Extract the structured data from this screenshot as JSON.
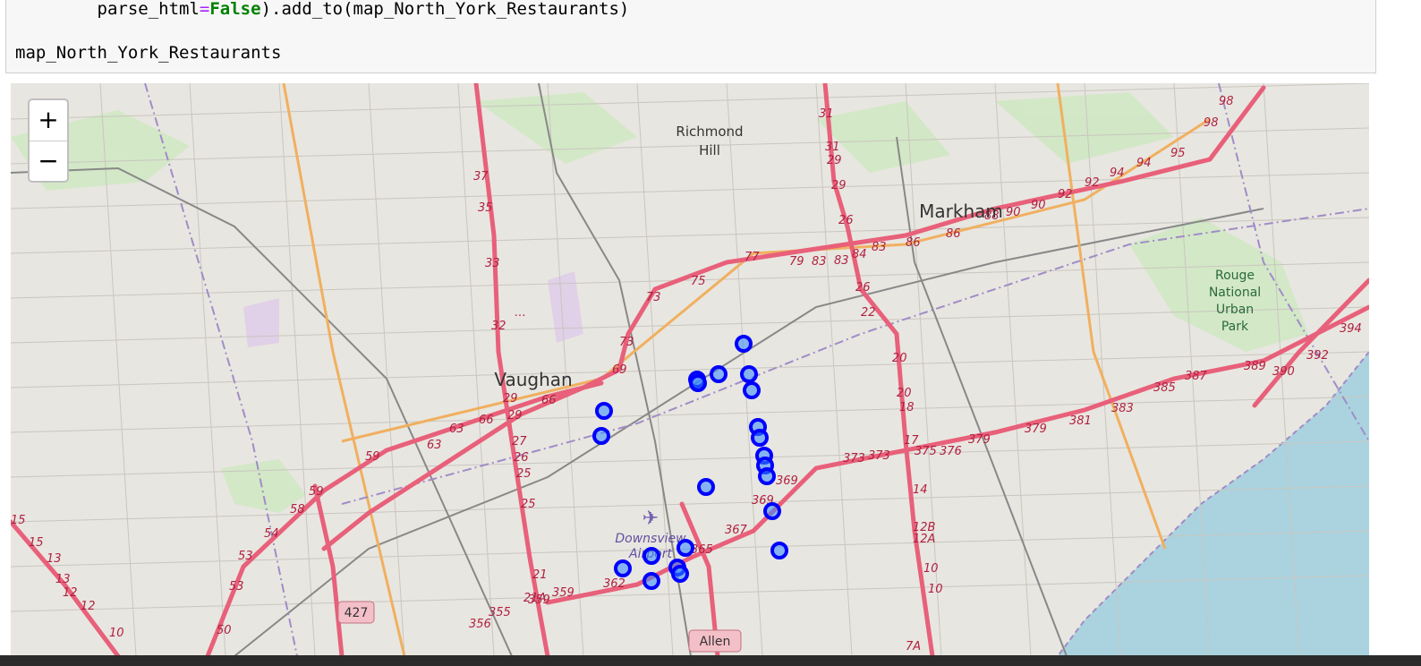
{
  "code": {
    "line1_prefix": "        parse_html",
    "line1_eq": "=",
    "line1_false": "False",
    "line1_suffix": ").add_to(map_North_York_Restaurants)",
    "line2": "map_North_York_Restaurants"
  },
  "map": {
    "zoom_in_label": "+",
    "zoom_out_label": "−",
    "places": {
      "richmond1": "Richmond",
      "richmond2": "Hill",
      "markham": "Markham",
      "vaughan": "Vaughan",
      "rouge1": "Rouge",
      "rouge2": "National",
      "rouge3": "Urban",
      "rouge4": "Park",
      "downsview1": "Downsview",
      "downsview2": "Airport",
      "shield_427": "427",
      "shield_allen": "Allen"
    },
    "marker_color": "#0000ff",
    "marker_fill": "#3388ff"
  }
}
